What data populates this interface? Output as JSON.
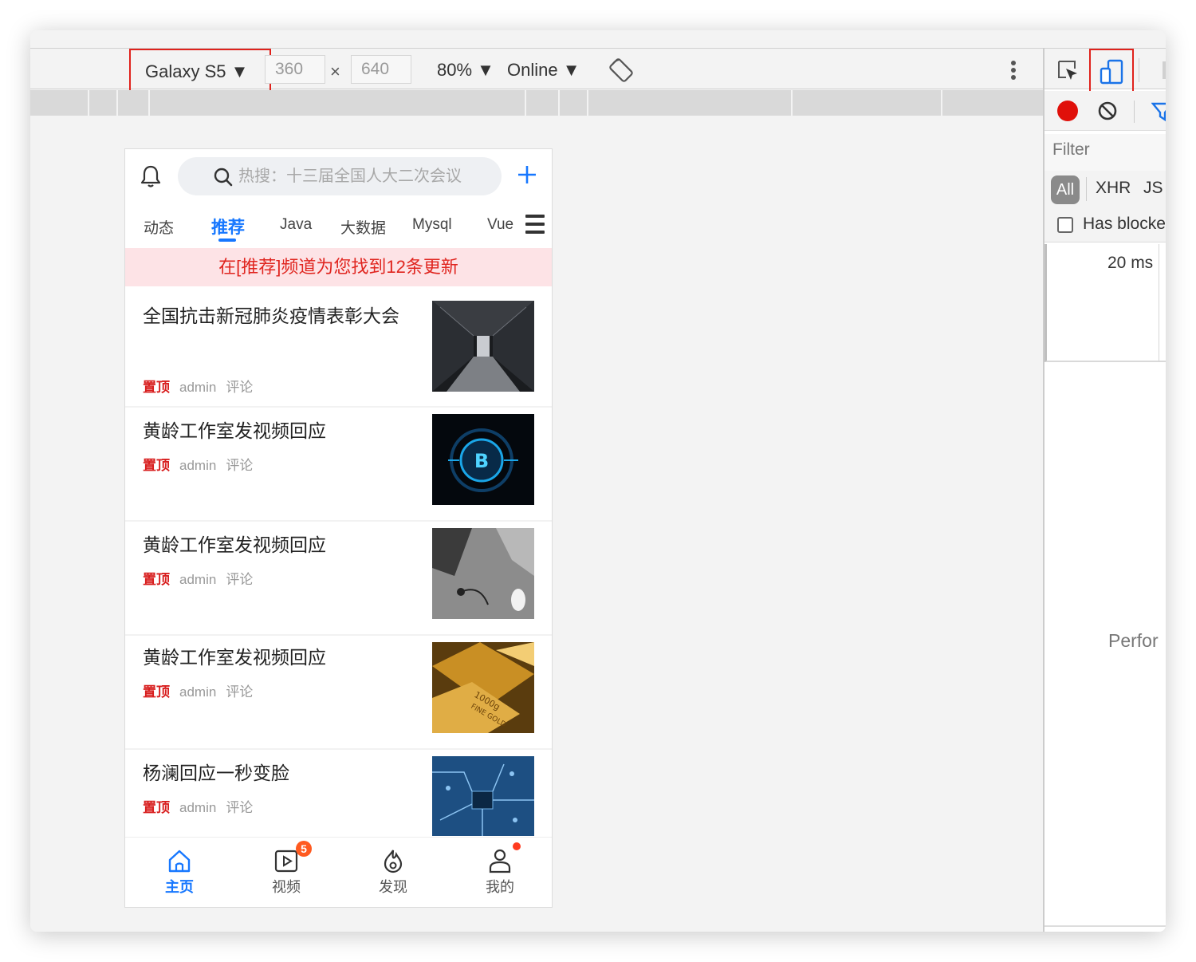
{
  "toolbar": {
    "device": "Galaxy S5 ▼",
    "width": "360",
    "times": "×",
    "height": "640",
    "zoom": "80% ▼",
    "network": "Online ▼"
  },
  "app": {
    "search_placeholder": "热搜：十三届全国人大二次会议",
    "channels": [
      "动态",
      "推荐",
      "Java",
      "大数据",
      "Mysql",
      "Vue"
    ],
    "active_channel": "推荐",
    "update_banner": "在[推荐]频道为您找到12条更新",
    "news": [
      {
        "title": "全国抗击新冠肺炎疫情表彰大会",
        "tag": "置顶",
        "author": "admin",
        "comments": "评论",
        "thumb": "server-corridor"
      },
      {
        "title": "黄龄工作室发视频回应",
        "tag": "置顶",
        "author": "admin",
        "comments": "评论",
        "thumb": "bitcoin"
      },
      {
        "title": "黄龄工作室发视频回应",
        "tag": "置顶",
        "author": "admin",
        "comments": "评论",
        "thumb": "desk-laptop"
      },
      {
        "title": "黄龄工作室发视频回应",
        "tag": "置顶",
        "author": "admin",
        "comments": "评论",
        "thumb": "gold-bars"
      },
      {
        "title": "杨澜回应一秒变脸",
        "tag": "置顶",
        "author": "admin",
        "comments": "评论",
        "thumb": "circuit-board"
      }
    ],
    "tabbar": {
      "home": "主页",
      "video": "视频",
      "video_badge": "5",
      "discover": "发现",
      "mine": "我的"
    },
    "accent_color": "#1677ff"
  },
  "devtools": {
    "filter_placeholder": "Filter",
    "type_all": "All",
    "type_xhr": "XHR",
    "type_js": "JS",
    "has_blocked": "Has blocke",
    "overview_time": "20 ms",
    "perf_text": "Perfor"
  },
  "colors": {
    "highlight_border": "#e0221c",
    "record": "#e0100a",
    "banner_bg": "#fde3e6",
    "banner_text": "#e0251f"
  }
}
